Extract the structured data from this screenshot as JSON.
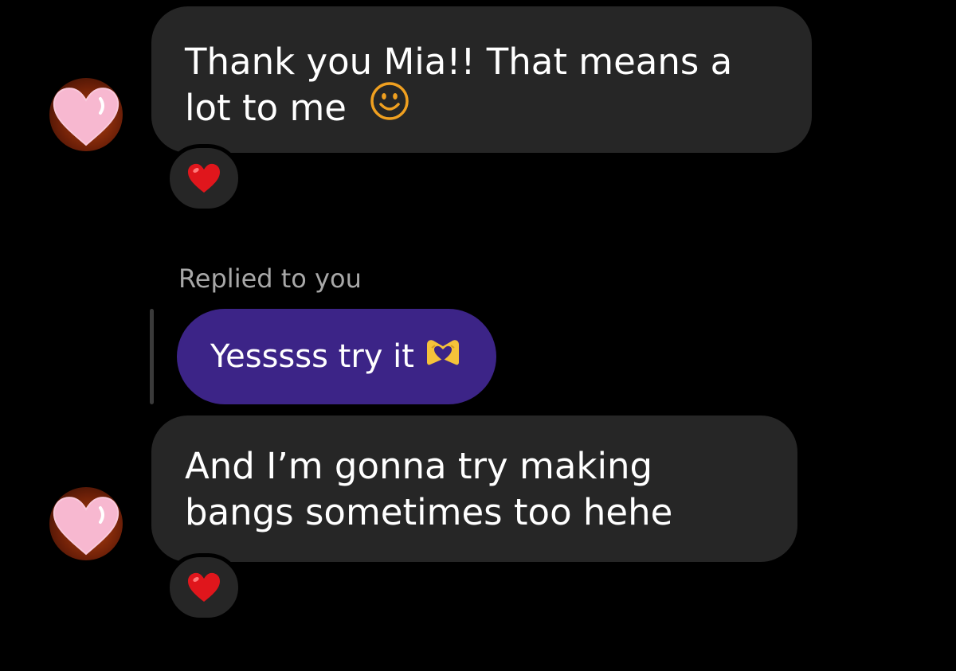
{
  "messages": [
    {
      "sender": "other",
      "text": "Thank you Mia!! That means a lot to me",
      "trailing_emoji": "smiley-icon",
      "reaction": "red-heart"
    },
    {
      "sender": "me",
      "reply_label": "Replied to you",
      "text": "Yesssss try it",
      "trailing_emoji": "heart-hands-icon"
    },
    {
      "sender": "other",
      "text": "And I’m gonna try making bangs sometimes too hehe",
      "reaction": "red-heart"
    }
  ],
  "colors": {
    "background": "#000000",
    "incoming_bubble": "#262626",
    "outgoing_bubble": "#3c2487",
    "reply_label": "#a8a8a8",
    "reaction_heart": "#e0161c",
    "smiley": "#f0a020",
    "avatar_heart": "#f7b8d0"
  }
}
